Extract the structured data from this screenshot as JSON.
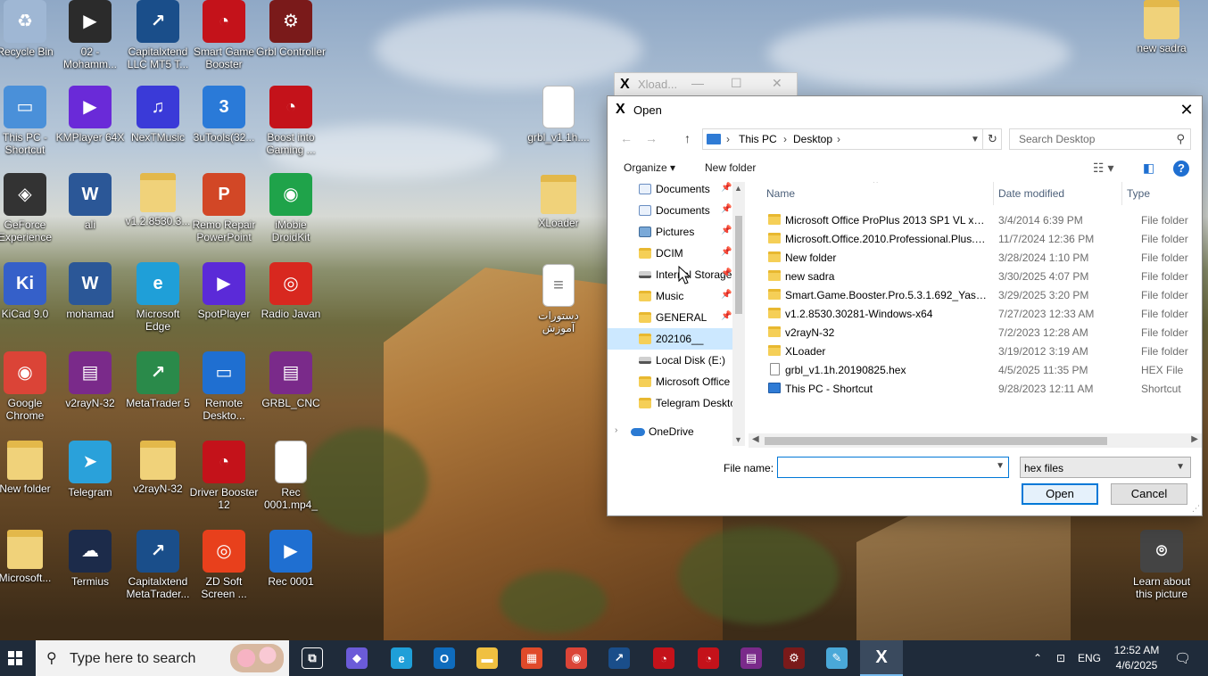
{
  "desktop": {
    "icons": [
      {
        "label": "Recycle Bin",
        "icon": "recycle-bin-icon",
        "color": "#9fb7d4"
      },
      {
        "label": "02 - Mohamm...",
        "icon": "video-file-icon",
        "color": "#2b2b2b"
      },
      {
        "label": "Capitalxtend LLC MT5 T...",
        "icon": "metatrader-icon",
        "color": "#1a4e8a"
      },
      {
        "label": "Smart Game Booster",
        "icon": "smart-game-booster-icon",
        "color": "#c4121a"
      },
      {
        "label": "Grbl Controller",
        "icon": "grbl-controller-icon",
        "color": "#7a1a1a"
      },
      {
        "label": "This PC - Shortcut",
        "icon": "computer-icon",
        "color": "#4a90d9"
      },
      {
        "label": "KMPlayer 64X",
        "icon": "kmplayer-icon",
        "color": "#6a2ad8"
      },
      {
        "label": "NexTMusic",
        "icon": "music-app-icon",
        "color": "#3a3ad8"
      },
      {
        "label": "3uTools(32...",
        "icon": "3utools-icon",
        "color": "#2a7ad8"
      },
      {
        "label": "Boost into Gaming ...",
        "icon": "boost-gaming-icon",
        "color": "#c4121a"
      },
      {
        "label": "GeForce Experience",
        "icon": "geforce-icon",
        "color": "#333333"
      },
      {
        "label": "ali",
        "icon": "word-doc-icon",
        "color": "#2b5797"
      },
      {
        "label": "v1.2.8530.3...",
        "icon": "folder-icon",
        "color": "#f0d27a"
      },
      {
        "label": "Remo Repair PowerPoint",
        "icon": "remo-repair-icon",
        "color": "#d24726"
      },
      {
        "label": "iMobie DroidKit",
        "icon": "droidkit-icon",
        "color": "#1fa34a"
      },
      {
        "label": "KiCad 9.0",
        "icon": "kicad-icon",
        "color": "#3560c9"
      },
      {
        "label": "mohamad",
        "icon": "word-doc-icon",
        "color": "#2b5797"
      },
      {
        "label": "Microsoft Edge",
        "icon": "edge-icon",
        "color": "#1f9fd8"
      },
      {
        "label": "SpotPlayer",
        "icon": "spotplayer-icon",
        "color": "#5b2ad8"
      },
      {
        "label": "Radio Javan",
        "icon": "radio-javan-icon",
        "color": "#d8281f"
      },
      {
        "label": "Google Chrome",
        "icon": "chrome-icon",
        "color": "#db4437"
      },
      {
        "label": "v2rayN-32",
        "icon": "winrar-icon",
        "color": "#7a2a8a"
      },
      {
        "label": "MetaTrader 5",
        "icon": "metatrader-icon",
        "color": "#2a8a4a"
      },
      {
        "label": "Remote Deskto...",
        "icon": "remote-desktop-icon",
        "color": "#1f6fd1"
      },
      {
        "label": "GRBL_CNC",
        "icon": "winrar-icon",
        "color": "#7a2a8a"
      },
      {
        "label": "New folder",
        "icon": "folder-icon",
        "color": "#f0d27a"
      },
      {
        "label": "Telegram",
        "icon": "telegram-icon",
        "color": "#2aa1da"
      },
      {
        "label": "v2rayN-32",
        "icon": "folder-icon",
        "color": "#f0d27a"
      },
      {
        "label": "Driver Booster 12",
        "icon": "driver-booster-icon",
        "color": "#c4121a"
      },
      {
        "label": "Rec 0001.mp4_",
        "icon": "blank-file-icon",
        "color": "#ffffff"
      },
      {
        "label": "Microsoft...",
        "icon": "folder-icon",
        "color": "#f0d27a"
      },
      {
        "label": "Termius",
        "icon": "termius-icon",
        "color": "#1c2b4a"
      },
      {
        "label": "Capitalxtend MetaTrader...",
        "icon": "metatrader-icon",
        "color": "#1a4e8a"
      },
      {
        "label": "ZD Soft Screen ...",
        "icon": "zd-soft-icon",
        "color": "#e8401c"
      },
      {
        "label": "Rec 0001",
        "icon": "video-file-icon",
        "color": "#1f6fd1"
      },
      {
        "label": "grbl_v1.1h....",
        "icon": "blank-file-icon",
        "color": "#ffffff"
      },
      {
        "label": "XLoader",
        "icon": "folder-icon",
        "color": "#f0d27a"
      },
      {
        "label": "دستورات آموزش",
        "icon": "text-file-icon",
        "color": "#ffffff"
      },
      {
        "label": "new sadra",
        "icon": "folder-icon",
        "color": "#f0d27a"
      },
      {
        "label": "Learn about this picture",
        "icon": "camera-icon",
        "color": "#444444"
      }
    ]
  },
  "background_window": {
    "title": "Xload..."
  },
  "dialog": {
    "title": "Open",
    "breadcrumb": [
      "This PC",
      "Desktop"
    ],
    "search_placeholder": "Search Desktop",
    "toolbar": {
      "organize": "Organize",
      "new_folder": "New folder"
    },
    "nav_items": [
      {
        "label": "Documents",
        "icon": "documents-icon",
        "pinned": true
      },
      {
        "label": "Documents",
        "icon": "documents-icon",
        "pinned": true
      },
      {
        "label": "Pictures",
        "icon": "pictures-icon",
        "pinned": true
      },
      {
        "label": "DCIM",
        "icon": "folder-icon",
        "pinned": true
      },
      {
        "label": "Internal Storage",
        "icon": "drive-icon",
        "pinned": true
      },
      {
        "label": "Music",
        "icon": "folder-icon",
        "pinned": true
      },
      {
        "label": "GENERAL",
        "icon": "folder-icon",
        "pinned": true
      },
      {
        "label": "202106__",
        "icon": "folder-icon",
        "pinned": false
      },
      {
        "label": "Local Disk (E:)",
        "icon": "drive-icon",
        "pinned": false
      },
      {
        "label": "Microsoft Office",
        "icon": "folder-icon",
        "pinned": false
      },
      {
        "label": "Telegram Deskto",
        "icon": "folder-icon",
        "pinned": false
      },
      {
        "label": "OneDrive",
        "icon": "cloud-icon",
        "pinned": false
      }
    ],
    "columns": {
      "name": "Name",
      "date": "Date modified",
      "type": "Type"
    },
    "files": [
      {
        "name": "Microsoft Office ProPlus 2013 SP1 VL x64...",
        "date": "3/4/2014 6:39 PM",
        "type": "File folder",
        "kind": "folder"
      },
      {
        "name": "Microsoft.Office.2010.Professional.Plus.w...",
        "date": "11/7/2024 12:36 PM",
        "type": "File folder",
        "kind": "folder"
      },
      {
        "name": "New folder",
        "date": "3/28/2024 1:10 PM",
        "type": "File folder",
        "kind": "folder"
      },
      {
        "name": "new sadra",
        "date": "3/30/2025 4:07 PM",
        "type": "File folder",
        "kind": "folder"
      },
      {
        "name": "Smart.Game.Booster.Pro.5.3.1.692_YasDL....",
        "date": "3/29/2025 3:20 PM",
        "type": "File folder",
        "kind": "folder"
      },
      {
        "name": "v1.2.8530.30281-Windows-x64",
        "date": "7/27/2023 12:33 AM",
        "type": "File folder",
        "kind": "folder"
      },
      {
        "name": "v2rayN-32",
        "date": "7/2/2023 12:28 AM",
        "type": "File folder",
        "kind": "folder"
      },
      {
        "name": "XLoader",
        "date": "3/19/2012 3:19 AM",
        "type": "File folder",
        "kind": "folder"
      },
      {
        "name": "grbl_v1.1h.20190825.hex",
        "date": "4/5/2025 11:35 PM",
        "type": "HEX File",
        "kind": "file"
      },
      {
        "name": "This PC - Shortcut",
        "date": "9/28/2023 12:11 AM",
        "type": "Shortcut",
        "kind": "shortcut"
      }
    ],
    "file_name_label": "File name:",
    "file_name_value": "",
    "file_type": "hex files",
    "open_label": "Open",
    "cancel_label": "Cancel"
  },
  "taskbar": {
    "search_placeholder": "Type here to search",
    "apps": [
      {
        "icon": "task-view-icon",
        "color": "#1f2b3a"
      },
      {
        "icon": "copilot-icon",
        "color": "#6b5bd8"
      },
      {
        "icon": "edge-icon",
        "color": "#1f9fd8"
      },
      {
        "icon": "outlook-icon",
        "color": "#0f6cbd"
      },
      {
        "icon": "file-explorer-icon",
        "color": "#f0c040"
      },
      {
        "icon": "microsoft-store-icon",
        "color": "#e04a2a"
      },
      {
        "icon": "chrome-icon",
        "color": "#db4437"
      },
      {
        "icon": "metatrader-icon",
        "color": "#1a4e8a"
      },
      {
        "icon": "driver-booster-icon",
        "color": "#c4121a"
      },
      {
        "icon": "smart-game-booster-icon",
        "color": "#c4121a"
      },
      {
        "icon": "winrar-icon",
        "color": "#7a2a8a"
      },
      {
        "icon": "grbl-controller-icon",
        "color": "#7a1a1a"
      },
      {
        "icon": "notepad-icon",
        "color": "#4aa8d8"
      },
      {
        "icon": "xloader-icon",
        "color": "#000000"
      }
    ],
    "language": "ENG",
    "time": "12:52 AM",
    "date": "4/6/2025"
  }
}
